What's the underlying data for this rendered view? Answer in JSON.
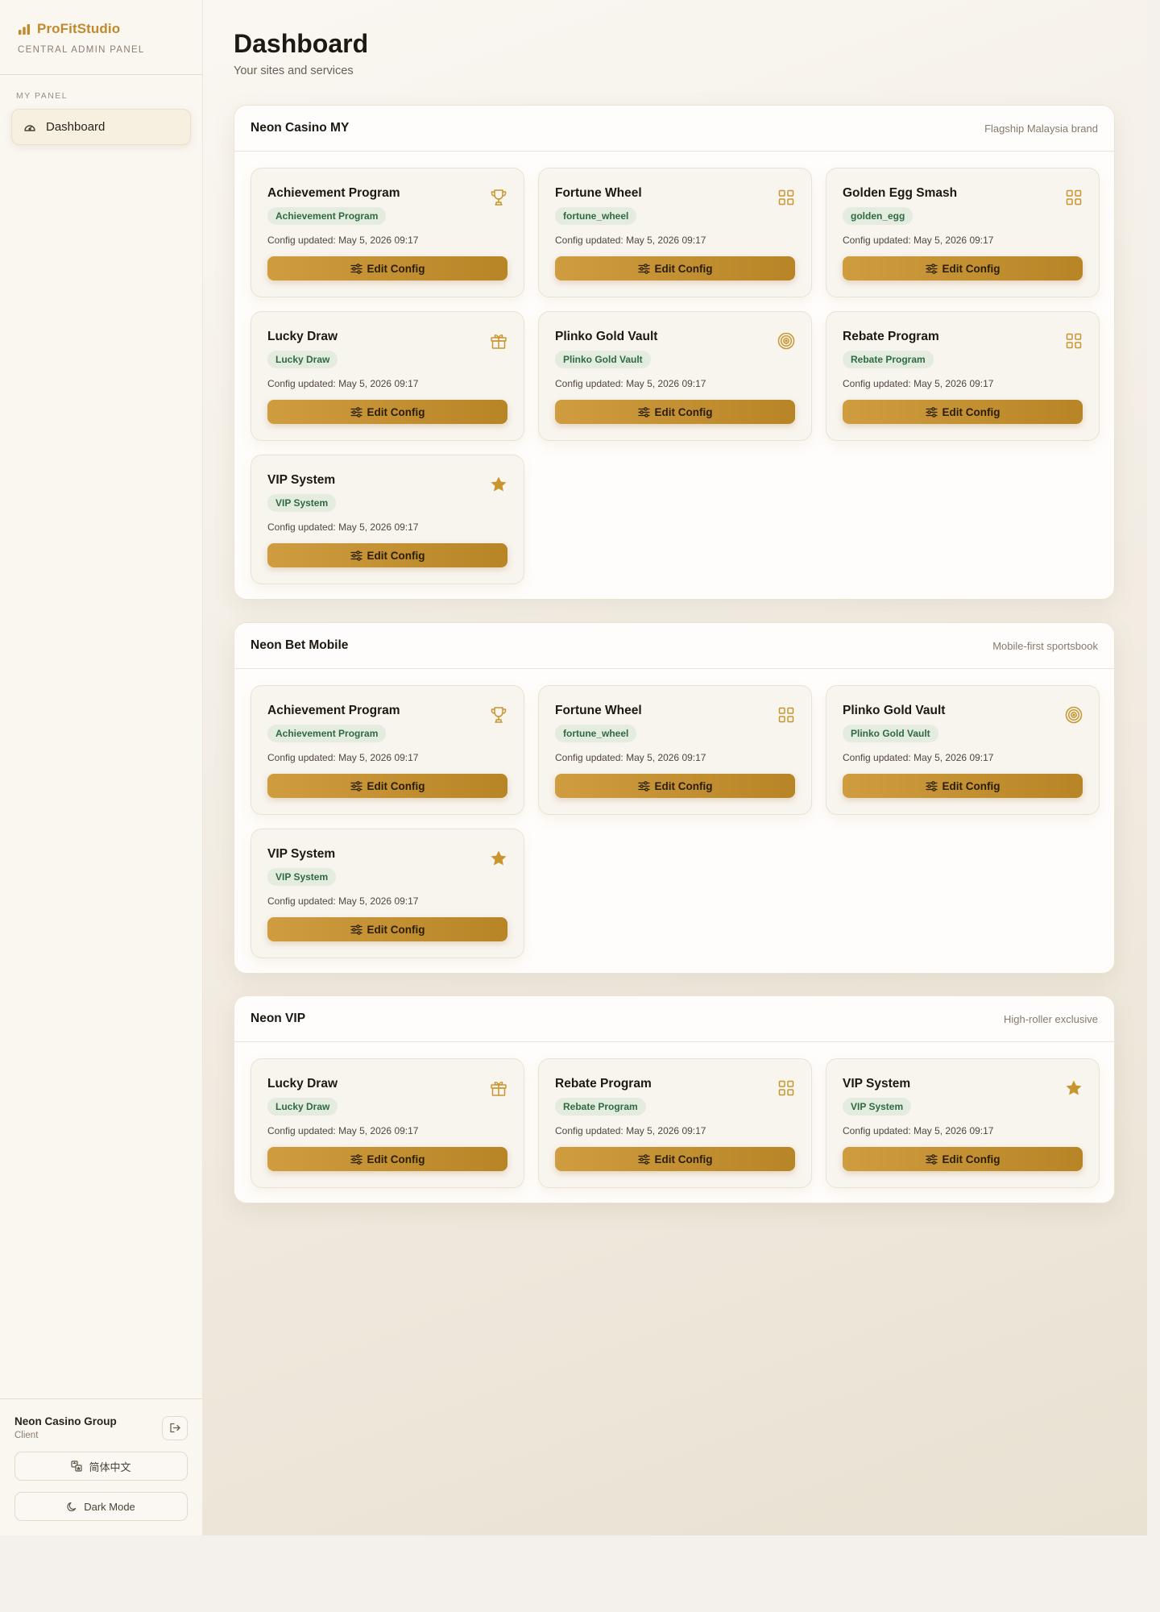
{
  "brand": {
    "name": "ProFitStudio",
    "subtitle": "CENTRAL ADMIN PANEL",
    "accent": "#c08a2c"
  },
  "nav": {
    "section_label": "MY PANEL",
    "items": [
      {
        "label": "Dashboard",
        "icon": "gauge-icon",
        "active": true
      }
    ]
  },
  "sidebar_footer": {
    "client_name": "Neon Casino Group",
    "client_role": "Client",
    "language_label": "简体中文",
    "theme_label": "Dark Mode"
  },
  "page": {
    "title": "Dashboard",
    "subtitle": "Your sites and services"
  },
  "groups": [
    {
      "title": "Neon Casino MY",
      "description": "Flagship Malaysia brand",
      "cards": [
        {
          "title": "Achievement Program",
          "badge": "Achievement Program",
          "updated": "Config updated: May 5, 2026 09:17",
          "button": "Edit Config",
          "icon": "trophy-icon"
        },
        {
          "title": "Fortune Wheel",
          "badge": "fortune_wheel",
          "updated": "Config updated: May 5, 2026 09:17",
          "button": "Edit Config",
          "icon": "grid-icon"
        },
        {
          "title": "Golden Egg Smash",
          "badge": "golden_egg",
          "updated": "Config updated: May 5, 2026 09:17",
          "button": "Edit Config",
          "icon": "grid-icon"
        },
        {
          "title": "Lucky Draw",
          "badge": "Lucky Draw",
          "updated": "Config updated: May 5, 2026 09:17",
          "button": "Edit Config",
          "icon": "gift-icon"
        },
        {
          "title": "Plinko Gold Vault",
          "badge": "Plinko Gold Vault",
          "updated": "Config updated: May 5, 2026 09:17",
          "button": "Edit Config",
          "icon": "target-icon"
        },
        {
          "title": "Rebate Program",
          "badge": "Rebate Program",
          "updated": "Config updated: May 5, 2026 09:17",
          "button": "Edit Config",
          "icon": "grid-icon"
        },
        {
          "title": "VIP System",
          "badge": "VIP System",
          "updated": "Config updated: May 5, 2026 09:17",
          "button": "Edit Config",
          "icon": "star-icon"
        }
      ]
    },
    {
      "title": "Neon Bet Mobile",
      "description": "Mobile-first sportsbook",
      "cards": [
        {
          "title": "Achievement Program",
          "badge": "Achievement Program",
          "updated": "Config updated: May 5, 2026 09:17",
          "button": "Edit Config",
          "icon": "trophy-icon"
        },
        {
          "title": "Fortune Wheel",
          "badge": "fortune_wheel",
          "updated": "Config updated: May 5, 2026 09:17",
          "button": "Edit Config",
          "icon": "grid-icon"
        },
        {
          "title": "Plinko Gold Vault",
          "badge": "Plinko Gold Vault",
          "updated": "Config updated: May 5, 2026 09:17",
          "button": "Edit Config",
          "icon": "target-icon"
        },
        {
          "title": "VIP System",
          "badge": "VIP System",
          "updated": "Config updated: May 5, 2026 09:17",
          "button": "Edit Config",
          "icon": "star-icon"
        }
      ]
    },
    {
      "title": "Neon VIP",
      "description": "High-roller exclusive",
      "cards": [
        {
          "title": "Lucky Draw",
          "badge": "Lucky Draw",
          "updated": "Config updated: May 5, 2026 09:17",
          "button": "Edit Config",
          "icon": "gift-icon"
        },
        {
          "title": "Rebate Program",
          "badge": "Rebate Program",
          "updated": "Config updated: May 5, 2026 09:17",
          "button": "Edit Config",
          "icon": "grid-icon"
        },
        {
          "title": "VIP System",
          "badge": "VIP System",
          "updated": "Config updated: May 5, 2026 09:17",
          "button": "Edit Config",
          "icon": "star-icon"
        }
      ]
    }
  ]
}
